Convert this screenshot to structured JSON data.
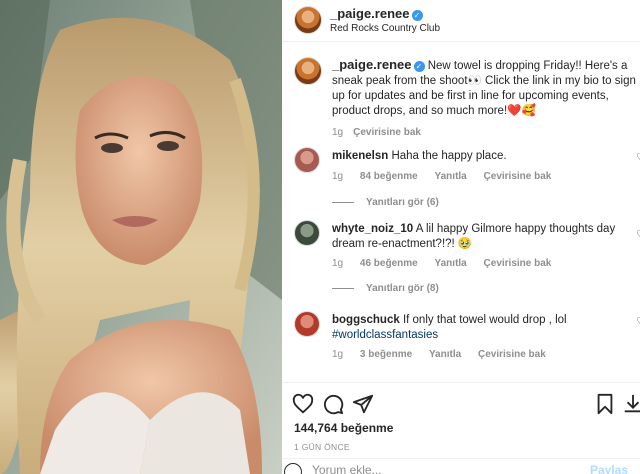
{
  "header": {
    "username": "_paige.renee",
    "location": "Red Rocks Country Club"
  },
  "caption": {
    "username": "_paige.renee",
    "text": "New towel is dropping Friday!! Here's a sneak peak from the shoot👀 Click the link in my bio to sign up for updates and be first in line for upcoming events, product drops, and so much more!❤️🥰",
    "age": "1g",
    "translate": "Çevirisine bak"
  },
  "comments": [
    {
      "username": "mikenelsn",
      "text": "Haha the happy place.",
      "age": "1g",
      "likes": "84 beğenme",
      "reply": "Yanıtla",
      "translate": "Çevirisine bak",
      "replies": "Yanıtları gör (6)",
      "avatar_color": "#a65a52"
    },
    {
      "username": "whyte_noiz_10",
      "text": "A lil happy Gilmore happy thoughts day dream re-enactment?!?! 🥹",
      "age": "1g",
      "likes": "46 beğenme",
      "reply": "Yanıtla",
      "translate": "Çevirisine bak",
      "replies": "Yanıtları gör (8)",
      "avatar_color": "#3b4a3a"
    },
    {
      "username": "boggschuck",
      "text": "If only that towel would drop , lol",
      "hashtag": "#worldclassfantasies",
      "age": "1g",
      "likes": "3 beğenme",
      "reply": "Yanıtla",
      "translate": "Çevirisine bak",
      "avatar_color": "#b23a2a"
    }
  ],
  "post": {
    "likes": "144,764 beğenme",
    "time": "1 GÜN ÖNCE"
  },
  "comment_box": {
    "placeholder": "Yorum ekle...",
    "share_label": "Paylaş"
  },
  "icons": {
    "like": "heart-icon",
    "comment": "comment-icon",
    "share": "send-icon",
    "save": "bookmark-icon",
    "download": "download-icon",
    "emoji": "emoji-icon",
    "verified": "verified-badge-icon"
  }
}
